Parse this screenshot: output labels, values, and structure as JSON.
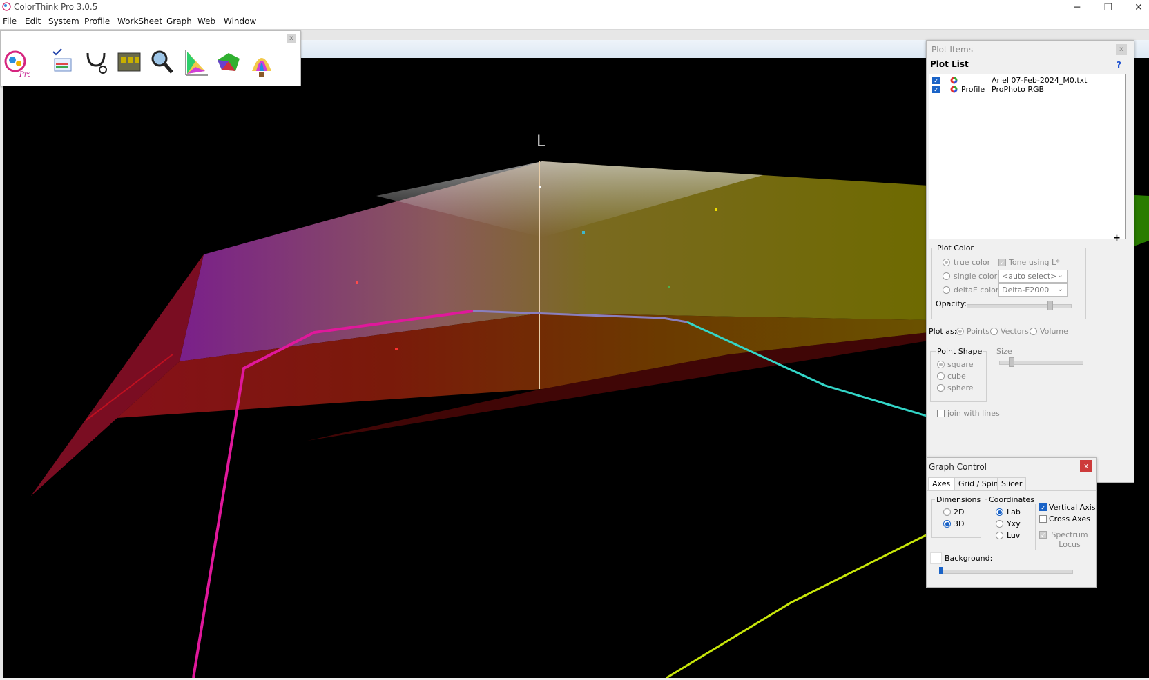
{
  "window": {
    "title": "ColorThink Pro 3.0.5",
    "minimize": "─",
    "maximize": "❐",
    "close": "✕"
  },
  "menu": {
    "items": [
      "File",
      "Edit",
      "System",
      "Profile",
      "WorkSheet",
      "Graph",
      "Web",
      "Window"
    ]
  },
  "toolbar": {
    "close": "x",
    "tools": [
      "brain-pro-icon",
      "checklist-icon",
      "stethoscope-icon",
      "worksheet-icon",
      "magnifier-icon",
      "gamut-2d-icon",
      "gamut-3d-icon",
      "balloon-icon"
    ]
  },
  "graph": {
    "axis_label": "L"
  },
  "plot_items": {
    "title": "Plot Items",
    "close": "x",
    "list_title": "Plot List",
    "help": "?",
    "rows": [
      {
        "checked": true,
        "type": "",
        "name": "Ariel 07-Feb-2024_M0.txt"
      },
      {
        "checked": true,
        "type": "Profile",
        "name": "ProPhoto RGB"
      }
    ],
    "add": "+",
    "plot_color": {
      "label": "Plot Color",
      "true_color": "true color",
      "tone_using": "Tone using L*",
      "single_color": "single color:",
      "single_value": "<auto select>",
      "deltae_color": "deltaE color:",
      "deltae_value": "Delta-E2000",
      "opacity": "Opacity:"
    },
    "plot_as": {
      "label": "Plot as:",
      "points": "Points",
      "vectors": "Vectors",
      "volume": "Volume"
    },
    "point_shape": {
      "label": "Point Shape",
      "square": "square",
      "cube": "cube",
      "sphere": "sphere"
    },
    "size": "Size",
    "join_lines": "join with lines"
  },
  "graph_control": {
    "title": "Graph Control",
    "close": "x",
    "tabs": [
      "Axes",
      "Grid / Spin",
      "Slicer"
    ],
    "dimensions": {
      "label": "Dimensions",
      "d2": "2D",
      "d3": "3D"
    },
    "coordinates": {
      "label": "Coordinates",
      "lab": "Lab",
      "yxy": "Yxy",
      "luv": "Luv"
    },
    "vertical_axis": "Vertical Axis",
    "cross_axes": "Cross Axes",
    "spectrum_locus": "Spectrum Locus",
    "background": "Background:"
  }
}
